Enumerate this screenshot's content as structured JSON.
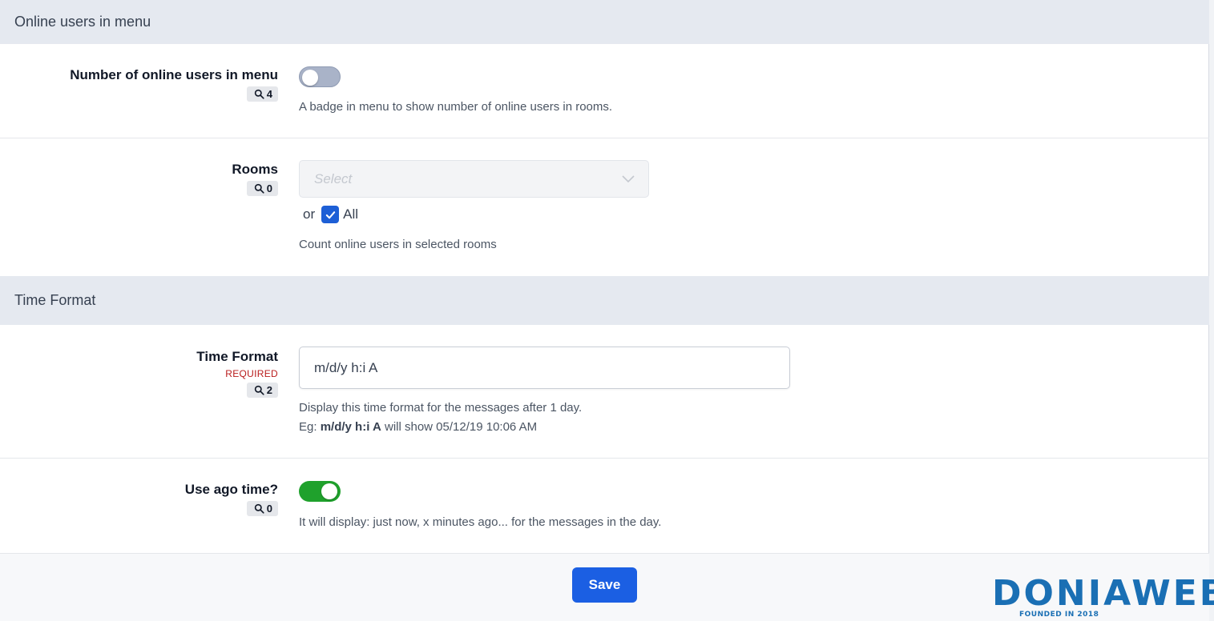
{
  "sections": [
    {
      "title": "Online users in menu"
    },
    {
      "title": "Time Format"
    }
  ],
  "fields": {
    "online_users": {
      "label": "Number of online users in menu",
      "badge_count": "4",
      "toggle_on": false,
      "help": "A badge in menu to show number of online users in rooms."
    },
    "rooms": {
      "label": "Rooms",
      "badge_count": "0",
      "select_placeholder": "Select",
      "or_text": "or",
      "all_label": "All",
      "all_checked": true,
      "help": "Count online users in selected rooms"
    },
    "time_format": {
      "label": "Time Format",
      "required": "REQUIRED",
      "badge_count": "2",
      "value": "m/d/y h:i A",
      "help_line1": "Display this time format for the messages after 1 day.",
      "help_eg": "Eg:",
      "help_example_format": "m/d/y h:i A",
      "help_example_result": "will show 05/12/19 10:06 AM"
    },
    "ago_time": {
      "label": "Use ago time?",
      "badge_count": "0",
      "toggle_on": true,
      "help": "It will display: just now, x minutes ago... for the messages in the day."
    }
  },
  "footer": {
    "save_label": "Save"
  },
  "watermark": {
    "brand": "DONIAWEB",
    "tagline": "FOUNDED IN 2018"
  },
  "colors": {
    "primary": "#1b5fe3",
    "toggle_on": "#1fa12c",
    "toggle_off": "#a9b3c8",
    "required": "#b91c1c",
    "section_bg": "#e5e9f0"
  }
}
